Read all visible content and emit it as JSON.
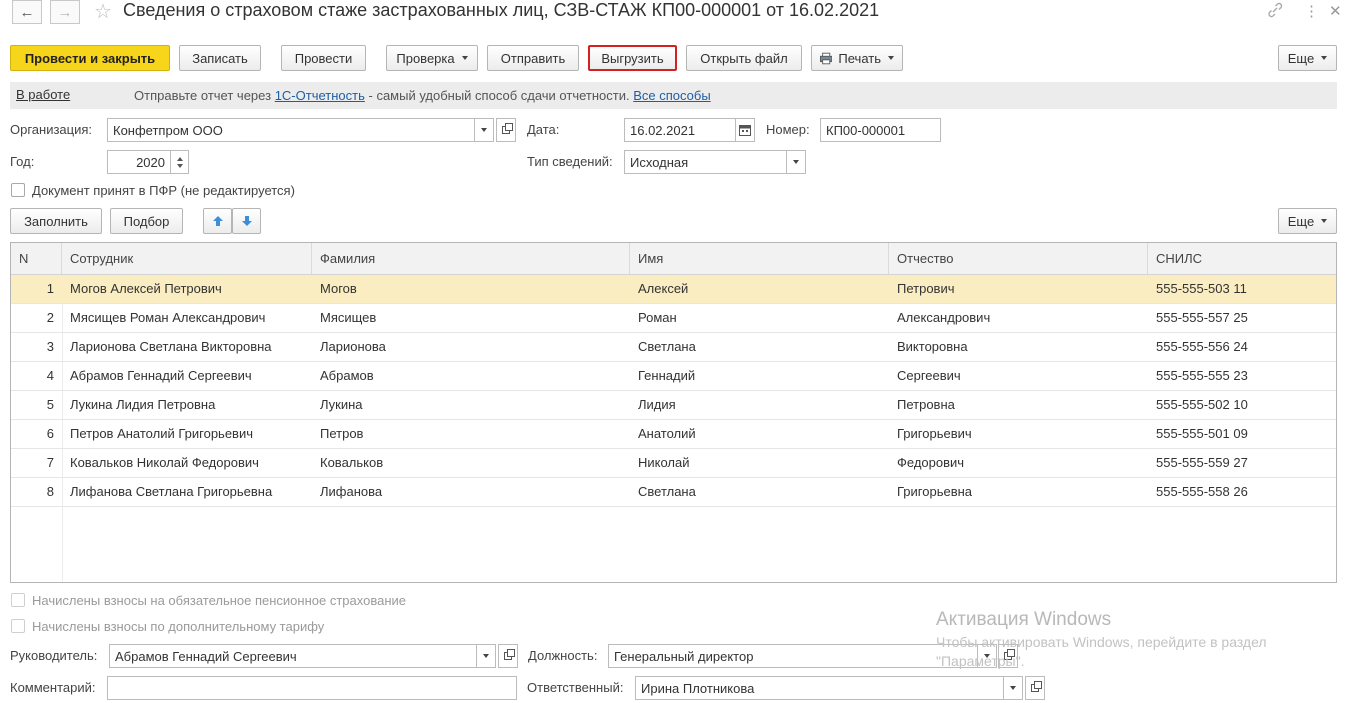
{
  "window": {
    "title": "Сведения о страховом стаже застрахованных лиц, СЗВ-СТАЖ КП00-000001 от 16.02.2021",
    "back_icon": "←",
    "forward_icon": "→",
    "star_icon": "☆",
    "link_icon": "🔗",
    "more_icon": "⋮",
    "close_icon": "✕"
  },
  "toolbar": {
    "post_close": "Провести и закрыть",
    "save": "Записать",
    "post": "Провести",
    "check": "Проверка",
    "send": "Отправить",
    "upload": "Выгрузить",
    "open_file": "Открыть файл",
    "print": "Печать",
    "more": "Еще"
  },
  "infobar": {
    "status": "В работе",
    "text_before": "Отправьте отчет через",
    "link1": "1С-Отчетность",
    "text_middle": "- самый удобный способ сдачи отчетности.",
    "link2": "Все способы"
  },
  "form": {
    "org_label": "Организация:",
    "org_value": "Конфетпром ООО",
    "date_label": "Дата:",
    "date_value": "16.02.2021",
    "number_label": "Номер:",
    "number_value": "КП00-000001",
    "year_label": "Год:",
    "year_value": "2020",
    "type_label": "Тип сведений:",
    "type_value": "Исходная",
    "accepted_label": "Документ принят в ПФР (не редактируется)"
  },
  "table_toolbar": {
    "fill": "Заполнить",
    "select": "Подбор",
    "up_icon": "▲",
    "down_icon": "▼",
    "more": "Еще"
  },
  "table": {
    "columns": [
      "N",
      "Сотрудник",
      "Фамилия",
      "Имя",
      "Отчество",
      "СНИЛС"
    ],
    "rows": [
      [
        "1",
        "Могов Алексей Петрович",
        "Могов",
        "Алексей",
        "Петрович",
        "555-555-503 11"
      ],
      [
        "2",
        "Мясищев Роман Александрович",
        "Мясищев",
        "Роман",
        "Александрович",
        "555-555-557 25"
      ],
      [
        "3",
        "Ларионова Светлана Викторовна",
        "Ларионова",
        "Светлана",
        "Викторовна",
        "555-555-556 24"
      ],
      [
        "4",
        "Абрамов Геннадий Сергеевич",
        "Абрамов",
        "Геннадий",
        "Сергеевич",
        "555-555-555 23"
      ],
      [
        "5",
        "Лукина Лидия Петровна",
        "Лукина",
        "Лидия",
        "Петровна",
        "555-555-502 10"
      ],
      [
        "6",
        "Петров Анатолий Григорьевич",
        "Петров",
        "Анатолий",
        "Григорьевич",
        "555-555-501 09"
      ],
      [
        "7",
        "Ковальков Николай Федорович",
        "Ковальков",
        "Николай",
        "Федорович",
        "555-555-559 27"
      ],
      [
        "8",
        "Лифанова Светлана Григорьевна",
        "Лифанова",
        "Светлана",
        "Григорьевна",
        "555-555-558 26"
      ]
    ]
  },
  "footer": {
    "pension_label": "Начислены взносы на обязательное пенсионное страхование",
    "extra_label": "Начислены взносы по дополнительному тарифу",
    "head_label": "Руководитель:",
    "head_value": "Абрамов Геннадий Сергеевич",
    "position_label": "Должность:",
    "position_value": "Генеральный директор",
    "comment_label": "Комментарий:",
    "comment_value": "",
    "responsible_label": "Ответственный:",
    "responsible_value": "Ирина Плотникова"
  },
  "watermark": {
    "line1": "Активация Windows",
    "line2": "Чтобы активировать Windows, перейдите в раздел",
    "line3": "\"Параметры\"."
  },
  "colors": {
    "primary_button": "#f7d51b",
    "selected_row": "#fbedc2",
    "highlight_outline": "#d62020",
    "link": "#1d5fa6"
  }
}
